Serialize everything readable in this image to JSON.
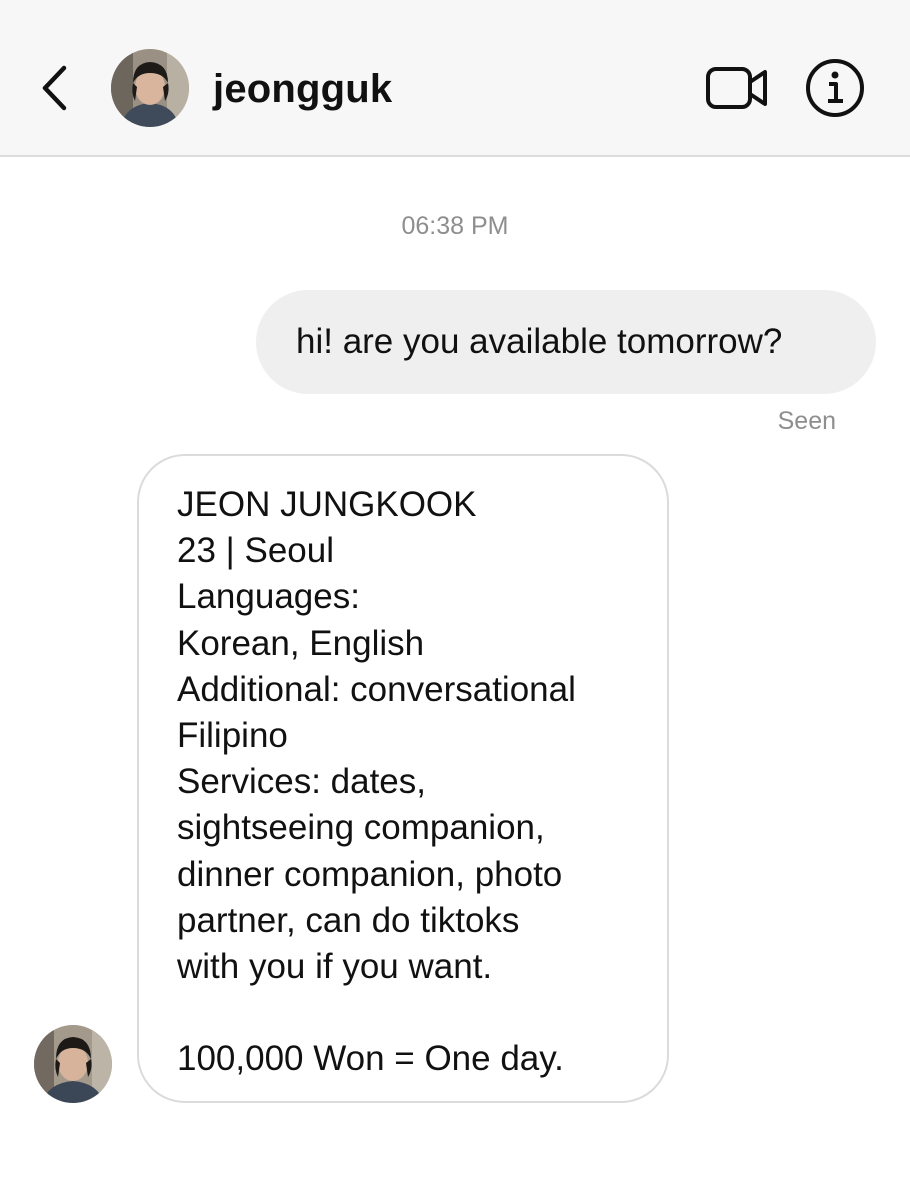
{
  "header": {
    "username": "jeongguk",
    "icons": {
      "back": "chevron-left-icon",
      "video": "video-camera-icon",
      "info": "info-icon"
    }
  },
  "thread": {
    "timestamp": "06:38 PM",
    "outgoing": {
      "text": "hi! are you available tomorrow?",
      "status": "Seen"
    },
    "incoming": {
      "lines": [
        "JEON JUNGKOOK",
        "23 | Seoul",
        "Languages:",
        "Korean, English",
        "Additional: conversational",
        "Filipino",
        "Services: dates,",
        "sightseeing companion,",
        "dinner companion, photo",
        "partner, can do tiktoks",
        "with you if you want.",
        "",
        "100,000 Won = One day."
      ]
    }
  },
  "colors": {
    "header_bg": "#f7f7f7",
    "outgoing_bubble": "#efefef",
    "muted_text": "#8e8e8e",
    "bubble_border": "#dbdbdb"
  }
}
